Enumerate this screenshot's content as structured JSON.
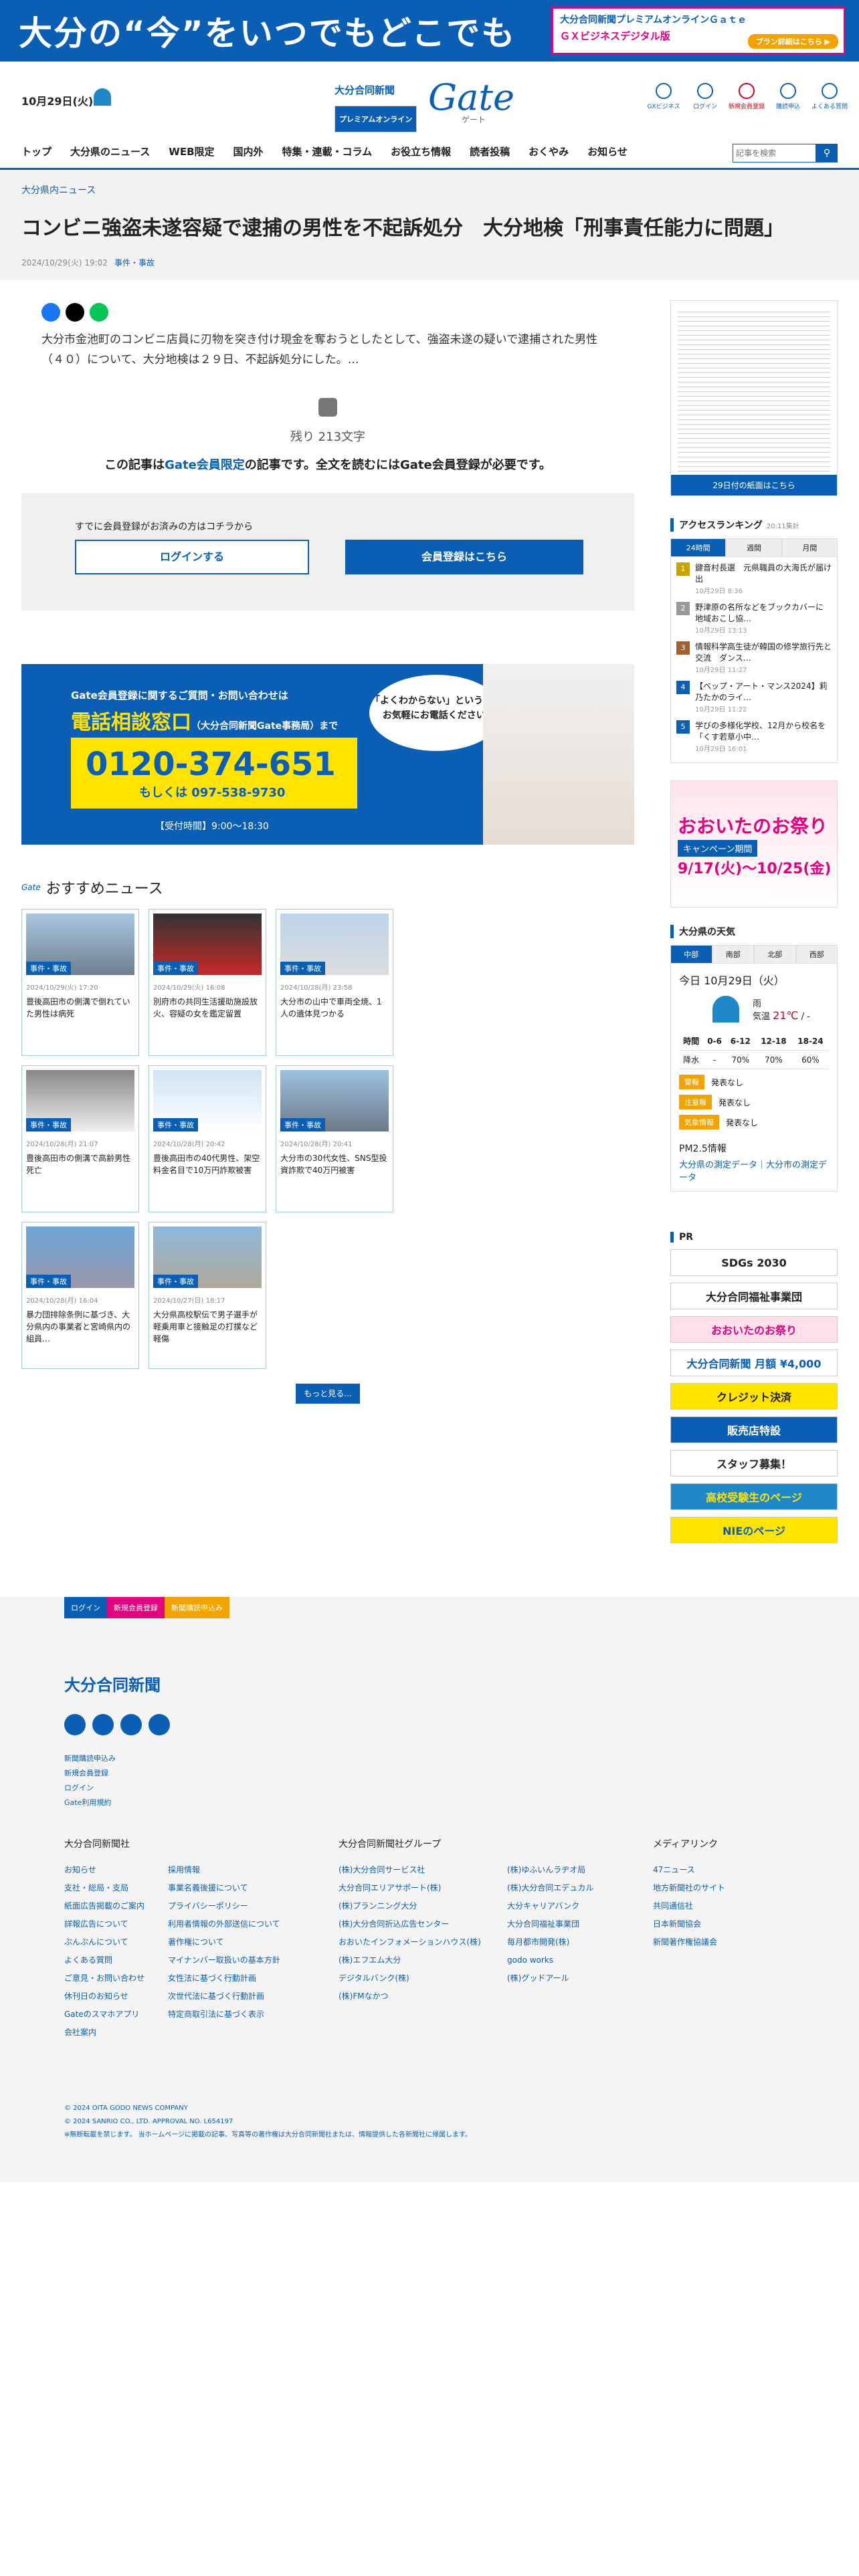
{
  "banner": {
    "headline": "大分の“今”をいつでもどこでも",
    "promo_l1": "大分合同新聞プレミアムオンラインＧａｔｅ",
    "promo_l2": "ＧＸビジネスデジタル版",
    "promo_btn": "プラン詳細はこちら ▶"
  },
  "header": {
    "date": "10月29日(火)",
    "logo_ja": "大分合同新聞",
    "logo_premium": "プレミアムオンライン",
    "logo_gate": "Gate",
    "logo_sub": "ゲート",
    "icons": [
      "GXビジネス",
      "ログイン",
      "新規会員登録",
      "購読申込",
      "よくある質問"
    ]
  },
  "nav": {
    "items": [
      "トップ",
      "大分県のニュース",
      "WEB限定",
      "国内外",
      "特集・連載・コラム",
      "お役立ち情報",
      "読者投稿",
      "おくやみ",
      "お知らせ"
    ],
    "search_placeholder": "記事を検索"
  },
  "article": {
    "category": "大分県内ニュース",
    "title": "コンビニ強盗未遂容疑で逮捕の男性を不起訴処分　大分地検「刑事責任能力に問題」",
    "date": "2024/10/29(火) 19:02",
    "tag": "事件・事故",
    "lead": "大分市金池町のコンビニ店員に刃物を突き付け現金を奪おうとしたとして、強盗未遂の疑いで逮捕された男性（４０）について、大分地検は２９日、不起訴処分にした。…",
    "remain": "残り 213文字",
    "need_pre": "この記事は",
    "need_strong": "Gate会員限定",
    "need_post": "の記事です。全文を読むにはGate会員登録が必要です。",
    "login_label": "すでに会員登録がお済みの方はコチラから",
    "login_btn": "ログインする",
    "register_btn": "会員登録はこちら"
  },
  "phone_ad": {
    "t1": "Gate会員登録に関するご質問・お問い合わせは",
    "t2": "電話相談窓口",
    "t2b": "（大分合同新聞Gate事務局）まで",
    "tel": "0120-374-651",
    "mobile": "もしくは 097-538-9730",
    "hours": "【受付時間】9:00～18:30",
    "bubble": "「よくわからない」という方はお気軽にお電話ください!"
  },
  "reco": {
    "gate": "Gate",
    "title": "おすすめニュース",
    "more": "もっと見る...",
    "cards": [
      {
        "tag": "事件・事故",
        "date": "2024/10/29(火) 17:20",
        "title": "豊後高田市の側溝で倒れていた男性は病死"
      },
      {
        "tag": "事件・事故",
        "date": "2024/10/29(火) 16:08",
        "title": "別府市の共同生活援助施設放火、容疑の女を鑑定留置"
      },
      {
        "tag": "事件・事故",
        "date": "2024/10/28(月) 23:58",
        "title": "大分市の山中で車両全焼、1人の遺体見つかる"
      },
      {
        "tag": "事件・事故",
        "date": "2024/10/28(月) 21:07",
        "title": "豊後高田市の側溝で高齢男性死亡"
      },
      {
        "tag": "事件・事故",
        "date": "2024/10/28(月) 20:42",
        "title": "豊後高田市の40代男性、架空料金名目で10万円詐欺被害"
      },
      {
        "tag": "事件・事故",
        "date": "2024/10/28(月) 20:41",
        "title": "大分市の30代女性、SNS型投資詐欺で40万円被害"
      },
      {
        "tag": "事件・事故",
        "date": "2024/10/28(月) 16:04",
        "title": "暴力団排除条例に基づき、大分県内の事業者と宮崎県内の組員…"
      },
      {
        "tag": "事件・事故",
        "date": "2024/10/27(日) 18:17",
        "title": "大分県高校駅伝で男子選手が軽乗用車と接触足の打撲など軽傷"
      }
    ]
  },
  "sidebar": {
    "paper_link": "29日付の紙面はこちら",
    "rank_title": "アクセスランキング",
    "rank_time": "20:11集計",
    "rank_tabs": [
      "24時間",
      "週間",
      "月間"
    ],
    "rank": [
      {
        "n": "1",
        "t": "鍵音村長選　元県職員の大海氏が届け出",
        "d": "10月29日 8:36"
      },
      {
        "n": "2",
        "t": "野津原の名所などをブックカバーに　地域おこし協…",
        "d": "10月29日 13:13"
      },
      {
        "n": "3",
        "t": "情報科学高生徒が韓国の修学旅行先と交流　ダンス…",
        "d": "10月29日 11:27"
      },
      {
        "n": "4",
        "t": "【ベップ・アート・マンス2024】莉乃たかのライ…",
        "d": "10月29日 11:22"
      },
      {
        "n": "5",
        "t": "学びの多様化学校、12月から校名を「くす若草小中…",
        "d": "10月29日 16:01"
      }
    ],
    "fest": {
      "a": "おおいたのお祭り",
      "b": "キャンペーン期間",
      "c": "9/17(火)～10/25(金)"
    },
    "weather_title": "大分県の天気",
    "weather_tabs": [
      "中部",
      "南部",
      "北部",
      "西部"
    ],
    "today": "今日 10月29日（火）",
    "wx": "雨",
    "temp_label": "気温",
    "temp": "21℃",
    "temp_low": "-",
    "wx_hours": [
      "時間",
      "0-6",
      "6-12",
      "12-18",
      "18-24"
    ],
    "wx_rain": [
      "降水",
      "-",
      "70%",
      "70%",
      "60%"
    ],
    "warnings": [
      {
        "k": "警報",
        "v": "発表なし"
      },
      {
        "k": "注意報",
        "v": "発表なし"
      },
      {
        "k": "気象情報",
        "v": "発表なし"
      }
    ],
    "pm": "PM2.5情報",
    "pm_link": "大分県の測定データ｜大分市の測定データ",
    "pr_title": "PR",
    "pr": [
      "SDGs 2030",
      "大分合同福祉事業団",
      "おおいたのお祭り",
      "大分合同新聞 月額 ¥4,000",
      "クレジット決済",
      "販売店特設",
      "スタッフ募集！",
      "高校受験生のページ",
      "NIEのページ"
    ]
  },
  "footer": {
    "btns": [
      "ログイン",
      "新規会員登録",
      "新聞購読申込み"
    ],
    "logo": "大分合同新聞",
    "links": [
      "新聞購読申込み",
      "新規会員登録",
      "ログイン",
      "Gate利用規約"
    ],
    "col1_title": "大分合同新聞社",
    "col1a": [
      "お知らせ",
      "支社・総局・支局",
      "紙面広告掲載のご案内",
      "詳報広告について",
      "ぷんぷんについて",
      "よくある質問",
      "ご意見・お問い合わせ",
      "休刊日のお知らせ",
      "Gateのスマホアプリ",
      "会社案内"
    ],
    "col1b": [
      "採用情報",
      "事業名義後援について",
      "プライバシーポリシー",
      "利用者情報の外部送信について",
      "著作権について",
      "マイナンバー取扱いの基本方針",
      "女性法に基づく行動計画",
      "次世代法に基づく行動計画",
      "特定商取引法に基づく表示"
    ],
    "col2_title": "大分合同新聞社グループ",
    "col2a": [
      "(株)大分合同サービス社",
      "大分合同エリアサポート(株)",
      "(株)プランニング大分",
      "(株)大分合同折込広告センター",
      "おおいたインフォメーションハウス(株)",
      "(株)エフエム大分",
      "デジタルバンク(株)",
      "(株)FMなかつ"
    ],
    "col2b": [
      "(株)ゆふいんラヂオ局",
      "(株)大分合同エデュカル",
      "大分キャリアバンク",
      "大分合同福祉事業団",
      "毎月都市開発(株)",
      "godo works",
      "(株)グッドアール"
    ],
    "col3_title": "メディアリンク",
    "col3": [
      "47ニュース",
      "地方新聞社のサイト",
      "共同通信社",
      "日本新聞協会",
      "新聞著作権協議会"
    ],
    "copy1": "© 2024 OITA GODO NEWS COMPANY",
    "copy2": "© 2024 SANRIO CO., LTD. APPROVAL NO. L654197",
    "copy3": "※無断転載を禁じます。 当ホームページに掲載の記事、写真等の著作権は大分合同新聞社または、情報提供した各新聞社に帰属します。"
  }
}
